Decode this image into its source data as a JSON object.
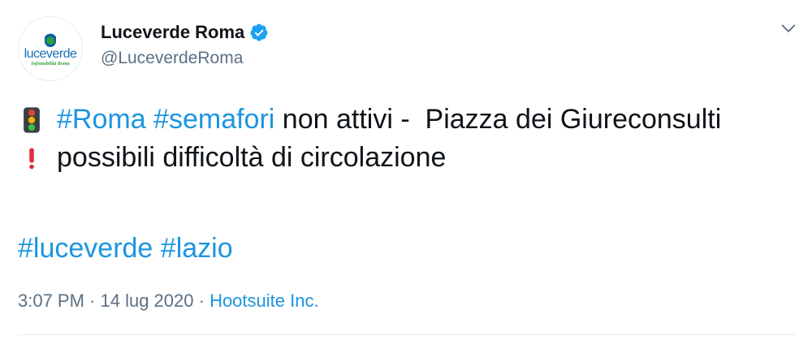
{
  "account": {
    "display_name": "Luceverde Roma",
    "handle": "@LuceverdeRoma",
    "avatar_logo_text": "luceverde",
    "avatar_logo_subtext": "Infomobilità Roma",
    "verified": true
  },
  "tweet": {
    "line1": {
      "emoji": "traffic-light-icon",
      "hashtag1": "#Roma",
      "hashtag2": "#semafori",
      "text": " non attivi -  Piazza dei Giureconsulti"
    },
    "line2": {
      "emoji": "exclamation-icon",
      "text": "possibili difficoltà di circolazione"
    },
    "hashtags": [
      "#luceverde",
      "#lazio"
    ]
  },
  "meta": {
    "time": "3:07 PM",
    "separator1": " · ",
    "date": "14 lug 2020",
    "separator2": " · ",
    "source": "Hootsuite Inc."
  },
  "colors": {
    "link": "#1b95e0",
    "text": "#0f1419",
    "secondary": "#5b7083",
    "verified": "#1da1f2"
  }
}
